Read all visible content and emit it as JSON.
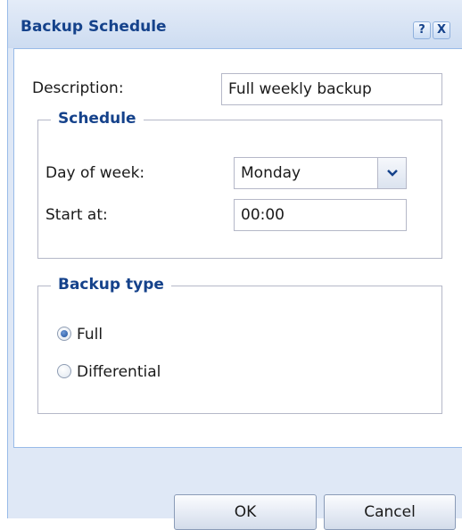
{
  "dialog": {
    "title": "Backup Schedule",
    "help_icon": "?",
    "close_icon": "X"
  },
  "form": {
    "description_label": "Description:",
    "description_value": "Full weekly backup"
  },
  "schedule": {
    "legend": "Schedule",
    "day_label": "Day of week:",
    "day_value": "Monday",
    "start_label": "Start at:",
    "start_value": "00:00"
  },
  "backup_type": {
    "legend": "Backup type",
    "options": [
      {
        "label": "Full",
        "checked": true
      },
      {
        "label": "Differential",
        "checked": false
      }
    ]
  },
  "buttons": {
    "ok": "OK",
    "cancel": "Cancel"
  },
  "colors": {
    "frame": "#dfe8f6",
    "title_text": "#15428b",
    "border": "#99bbe8"
  }
}
